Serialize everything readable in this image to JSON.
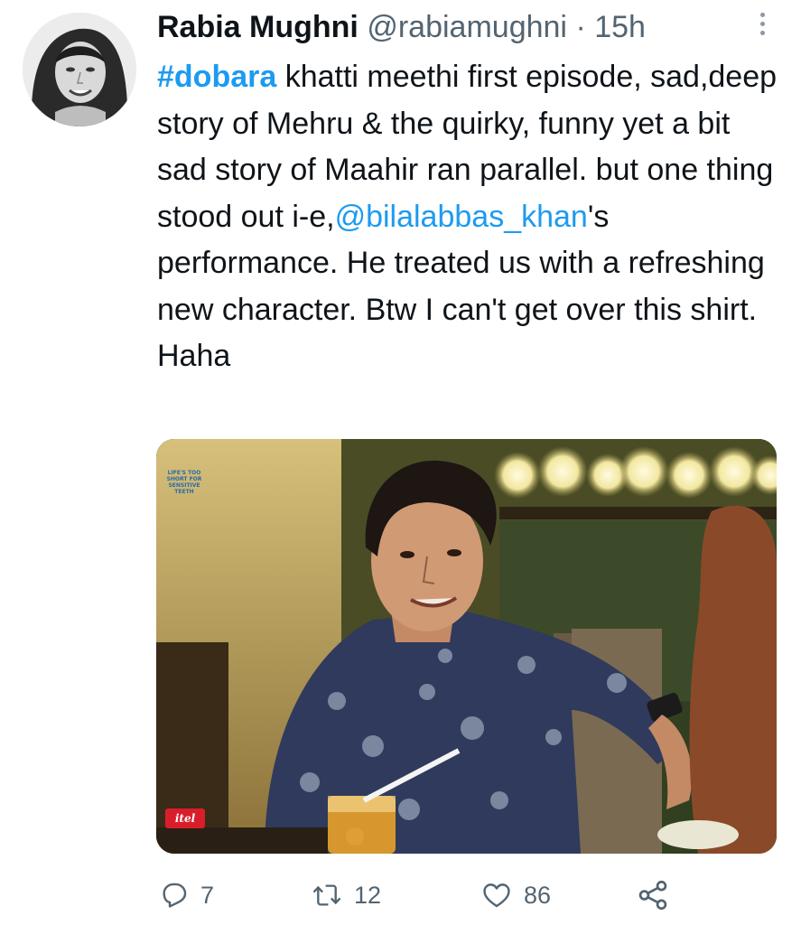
{
  "author": {
    "display_name": "Rabia Mughni",
    "handle": "@rabiamughni",
    "separator": "·",
    "time": "15h"
  },
  "tweet": {
    "hashtag": "#dobara",
    "text_part1": " khatti meethi first episode, sad,deep story of Mehru & the quirky, funny yet a bit sad story of Maahir ran parallel. but one thing stood out i-e,",
    "mention": "@bilalabbas_khan",
    "text_part2": "'s performance. He treated us with a refreshing new character. Btw I can't get over this shirt. Haha"
  },
  "media": {
    "overlay_badge": "LIFE'S TOO SHORT FOR SENSITIVE TEETH",
    "overlay_logo": "itel"
  },
  "actions": {
    "reply_count": "7",
    "retweet_count": "12",
    "like_count": "86"
  },
  "icons": {
    "more": "more-vertical-icon",
    "reply": "reply-icon",
    "retweet": "retweet-icon",
    "like": "heart-icon",
    "share": "share-icon"
  },
  "colors": {
    "link": "#1d9bf0",
    "text": "#0f1419",
    "secondary": "#536471"
  }
}
